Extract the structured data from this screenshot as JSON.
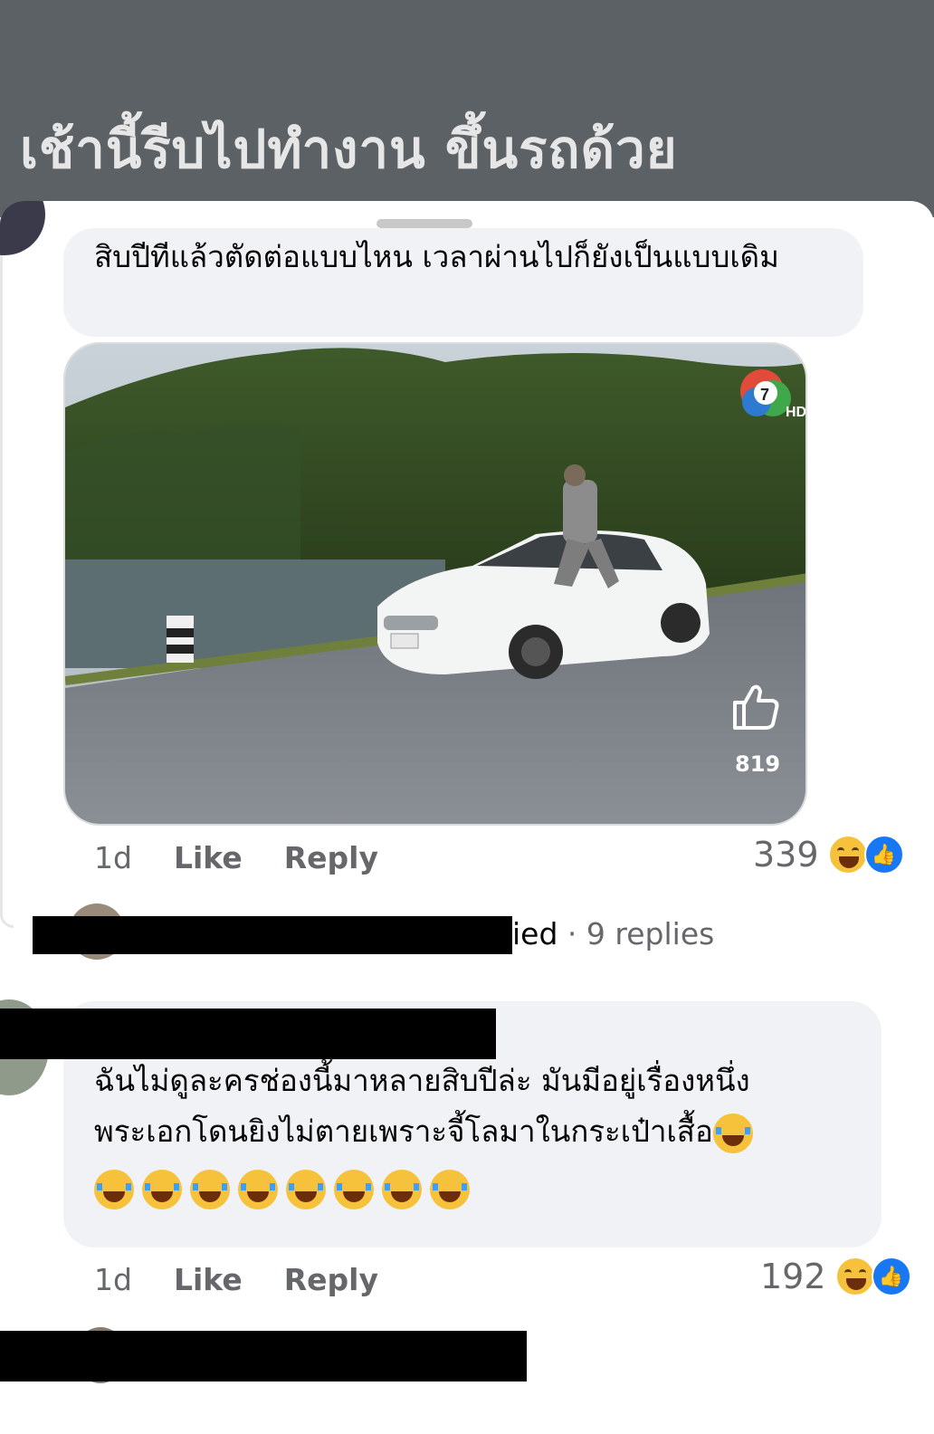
{
  "background_post": {
    "title": "เช้านี้รีบไปทำงาน ขึ้นรถด้วย"
  },
  "comment1": {
    "text": "สิบปีทีแล้วตัดต่อแบบไหน เวลาผ่านไปก็ยังเป็นแบบเดิม",
    "video_like_count": "819",
    "video_channel_badge": "HD",
    "time": "1d",
    "like_label": "Like",
    "reply_label": "Reply",
    "reaction_count": "339"
  },
  "comment2_collapsed": {
    "replied_fragment": "ied",
    "replies_text": "· 9 replies"
  },
  "comment3": {
    "text_line1": "ฉันไม่ดูละครช่องนี้มาหลายสิบปีล่ะ มันมีอยู่เรื่องหนึ่ง",
    "text_line2": "พระเอกโดนยิงไม่ตายเพราะจี้โลมาในกระเป๋าเสื้อ",
    "time": "1d",
    "like_label": "Like",
    "reply_label": "Reply",
    "reaction_count": "192"
  },
  "colors": {
    "header_bg": "#5c6166",
    "bubble_bg": "#f0f2f5",
    "secondary_text": "#65676b",
    "like_blue": "#1877f2",
    "haha_yellow": "#f7c23b"
  },
  "icons": [
    "haha-reaction-icon",
    "like-reaction-icon",
    "thumbs-up-icon",
    "channel-7-logo",
    "laughing-tears-emoji"
  ]
}
